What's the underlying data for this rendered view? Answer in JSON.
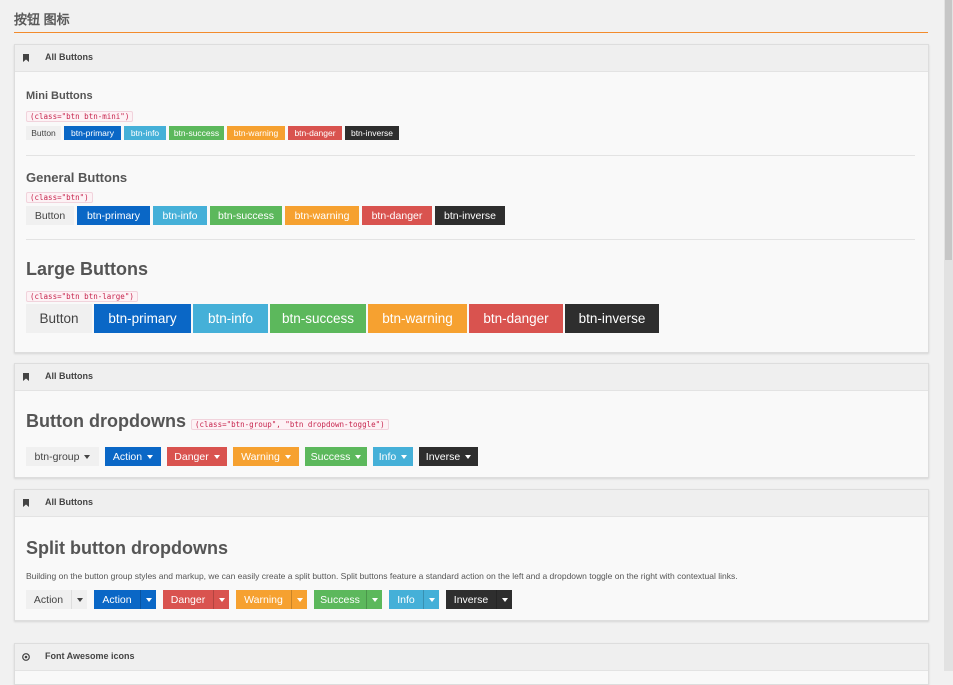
{
  "page": {
    "title": "按钮 图标"
  },
  "colors": {
    "accent": "#f28b2c",
    "primary": "#0a67c6",
    "info": "#45b0d8",
    "success": "#5cb85c",
    "warning": "#f6a130",
    "danger": "#d9534f",
    "inverse": "#2e2e2e"
  },
  "panels": {
    "all_buttons_1": {
      "title": "All Buttons",
      "icon": "bookmark-icon",
      "mini": {
        "title": "Mini Buttons",
        "code": "(class=\"btn btn-mini\")",
        "buttons": [
          "Button",
          "btn-primary",
          "btn-info",
          "btn-success",
          "btn-warning",
          "btn-danger",
          "btn-inverse"
        ]
      },
      "general": {
        "title": "General Buttons",
        "code": "(class=\"btn\")",
        "buttons": [
          "Button",
          "btn-primary",
          "btn-info",
          "btn-success",
          "btn-warning",
          "btn-danger",
          "btn-inverse"
        ]
      },
      "large": {
        "title": "Large Buttons",
        "code": "(class=\"btn btn-large\")",
        "buttons": [
          "Button",
          "btn-primary",
          "btn-info",
          "btn-success",
          "btn-warning",
          "btn-danger",
          "btn-inverse"
        ]
      }
    },
    "all_buttons_2": {
      "title": "All Buttons",
      "icon": "bookmark-icon",
      "dropdowns": {
        "title": "Button dropdowns",
        "code": "(class=\"btn-group\", \"btn dropdown-toggle\")",
        "buttons": [
          "btn-group",
          "Action",
          "Danger",
          "Warning",
          "Success",
          "Info",
          "Inverse"
        ]
      }
    },
    "all_buttons_3": {
      "title": "All Buttons",
      "icon": "bookmark-icon",
      "split": {
        "title": "Split button dropdowns",
        "description": "Building on the button group styles and markup, we can easily create a split button. Split buttons feature a standard action on the left and a dropdown toggle on the right with contextual links.",
        "buttons": [
          "Action",
          "Action",
          "Danger",
          "Warning",
          "Success",
          "Info",
          "Inverse"
        ]
      }
    },
    "font_awesome": {
      "title": "Font Awesome icons",
      "icon": "target-icon"
    }
  }
}
